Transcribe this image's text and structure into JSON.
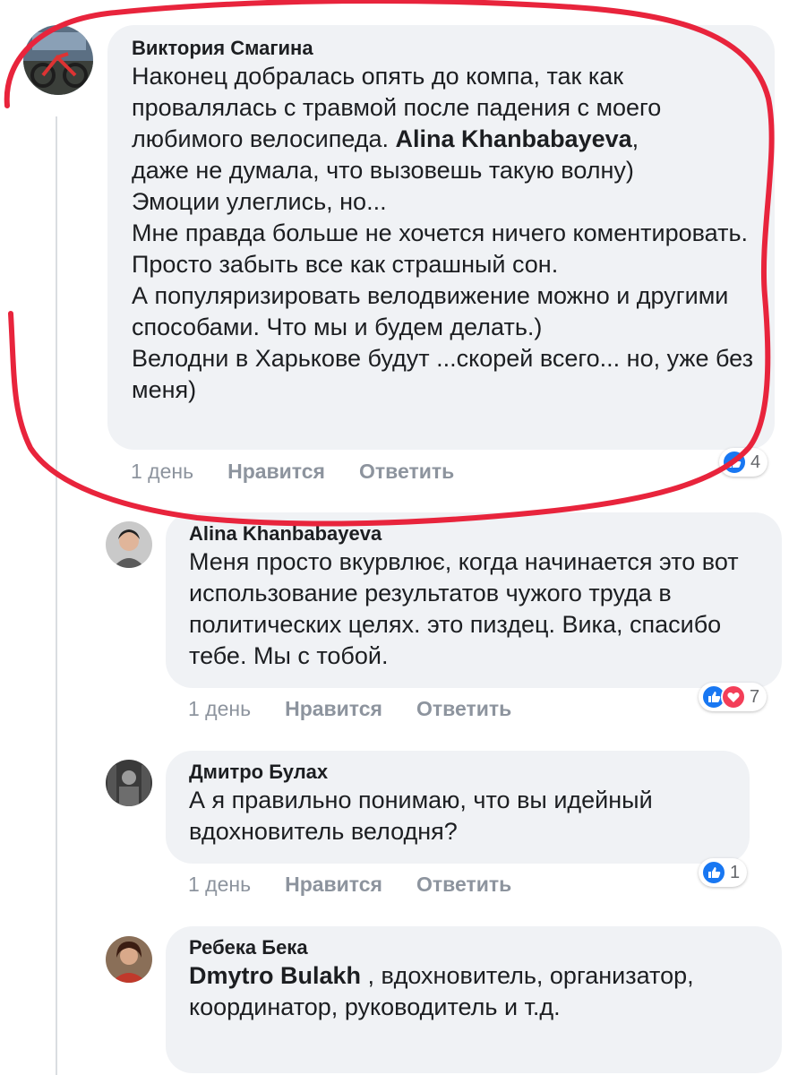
{
  "comments": [
    {
      "author": "Виктория Смагина",
      "text": "Наконец добралась опять до компа, так как провалялась с травмой после падения с моего любимого велосипеда. ",
      "mention": "Alina Khanbabayeva",
      "text_after": ",\nдаже не думала, что вызовешь такую волну)\nЭмоции улеглись, но...\nМне правда больше не хочется ничего коментировать. Просто забыть все как страшный сон.\nА популяризировать велодвижение можно и другими способами. Что мы и будем делать.)\nВелодни в Харькове будут ...скорей всего... но, уже без меня)",
      "time": "1 день",
      "like_label": "Нравится",
      "reply_label": "Ответить",
      "reaction_count": "4",
      "reactions": [
        "like"
      ]
    },
    {
      "author": "Alina Khanbabayeva",
      "text": "Меня просто вкурвлює, когда начинается это вот использование результатов чужого труда в политических целях. это пиздец. Вика, спасибо тебе. Мы с тобой.",
      "time": "1 день",
      "like_label": "Нравится",
      "reply_label": "Ответить",
      "reaction_count": "7",
      "reactions": [
        "like",
        "love"
      ]
    },
    {
      "author": "Дмитро Булах",
      "text": "А я правильно понимаю, что вы идейный вдохновитель велодня?",
      "time": "1 день",
      "like_label": "Нравится",
      "reply_label": "Ответить",
      "reaction_count": "1",
      "reactions": [
        "like"
      ]
    },
    {
      "author": "Ребека Бека",
      "mention": "Dmytro Bulakh",
      "text_after": " , вдохновитель, организатор, координатор, руководитель и т.д."
    }
  ],
  "colors": {
    "bubble": "#f0f2f5",
    "like": "#1877f2",
    "love": "#f33e58",
    "annotation": "#e8243c",
    "meta": "#8d949e"
  }
}
